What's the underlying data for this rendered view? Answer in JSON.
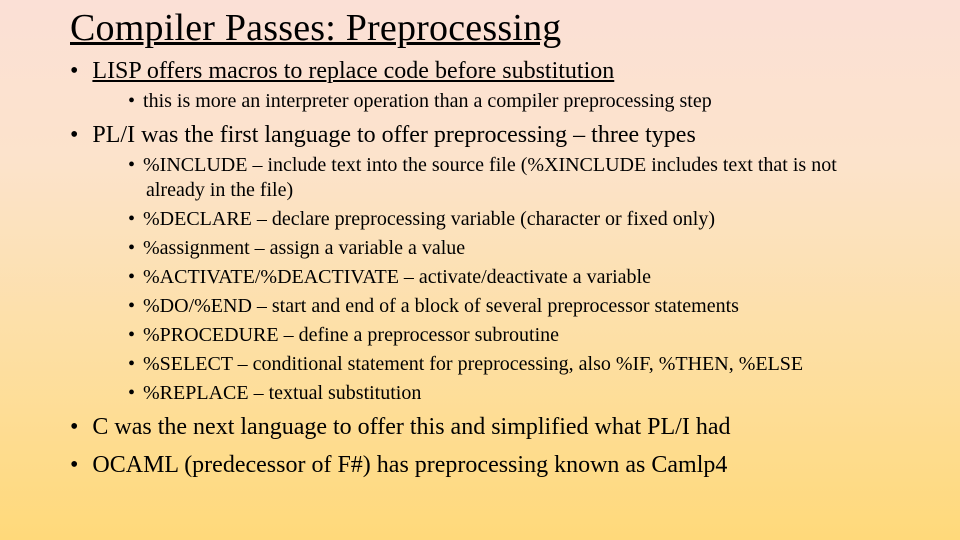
{
  "title": "Compiler Passes:  Preprocessing",
  "b1": {
    "text": "LISP offers macros to replace code before substitution",
    "sub": [
      "this is more an interpreter operation than a compiler preprocessing step"
    ]
  },
  "b2": {
    "text": "PL/I was the first language to offer preprocessing – three types",
    "sub": [
      "%INCLUDE – include text into the source file (%XINCLUDE includes text that is not already in the file)",
      "%DECLARE – declare preprocessing variable (character or fixed only)",
      "%assignment – assign a variable a value",
      "%ACTIVATE/%DEACTIVATE – activate/deactivate a variable",
      "%DO/%END – start and end of a block of several preprocessor statements",
      "%PROCEDURE – define a preprocessor subroutine",
      "%SELECT – conditional statement for preprocessing, also %IF, %THEN, %ELSE",
      "%REPLACE – textual substitution"
    ]
  },
  "b3": {
    "text": "C was the next language to offer this and simplified what PL/I had"
  },
  "b4": {
    "text": "OCAML (predecessor of F#) has preprocessing known as Camlp4"
  }
}
